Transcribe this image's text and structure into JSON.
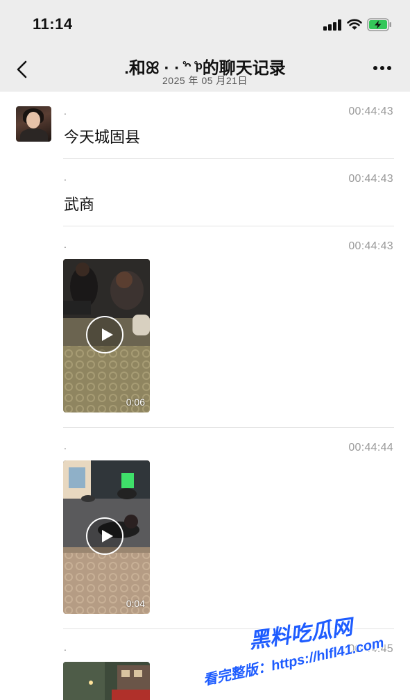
{
  "status_bar": {
    "time": "11:14",
    "icons": [
      "cellular-signal-icon",
      "wifi-icon",
      "battery-charging-icon"
    ],
    "battery_color": "#34c759"
  },
  "nav": {
    "title": ".和ꕤ · · ̊ᵔ ̊ᵖ的聊天记录",
    "subtitle": "2025 年 05 月21日",
    "back_icon": "chevron-left-icon",
    "more_icon": "more-horizontal-icon"
  },
  "messages": [
    {
      "sender": ".",
      "time": "00:44:43",
      "type": "text",
      "text": "今天城固县"
    },
    {
      "sender": ".",
      "time": "00:44:43",
      "type": "text",
      "text": "武商"
    },
    {
      "sender": ".",
      "time": "00:44:43",
      "type": "video",
      "duration": "0:06"
    },
    {
      "sender": ".",
      "time": "00:44:44",
      "type": "video",
      "duration": "0:04"
    },
    {
      "sender": ".",
      "time": "00:44:45",
      "type": "video",
      "duration": ""
    }
  ],
  "watermark": {
    "line1": "黑料吃瓜网",
    "line2": "看完整版：https://hlfl41.com"
  },
  "colors": {
    "header_bg": "#ededed",
    "timestamp": "#9a9a9a",
    "watermark": "#1e5cff"
  }
}
